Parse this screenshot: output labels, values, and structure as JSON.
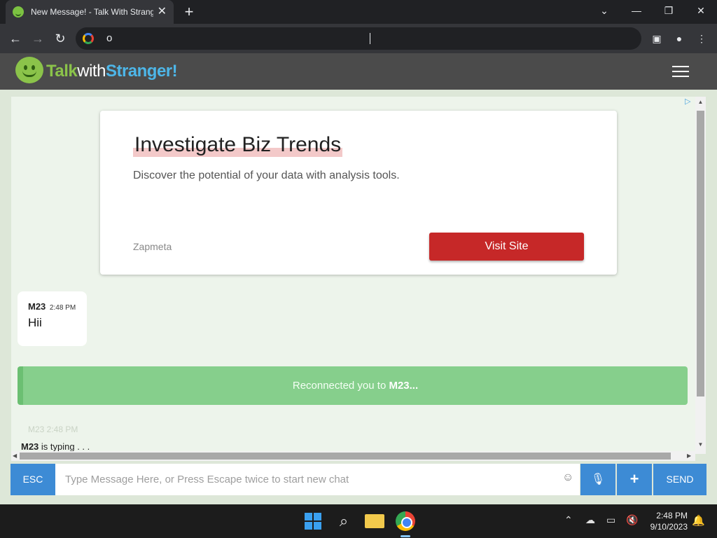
{
  "browser": {
    "tab_title": "New Message! - Talk With Strang",
    "tab_close": "✕",
    "new_tab": "+",
    "address_text": "o",
    "window_controls": {
      "menu": "⌄",
      "minimize": "—",
      "restore": "❐",
      "close": "✕"
    }
  },
  "site": {
    "logo_talk": "Talk",
    "logo_with": "with",
    "logo_stranger": "Stranger!"
  },
  "ad": {
    "marker": "▷",
    "headline": "Investigate Biz Trends",
    "description": "Discover the potential of your data with analysis tools.",
    "brand": "Zapmeta",
    "cta": "Visit Site"
  },
  "chat": {
    "messages": [
      {
        "sender": "M23",
        "time": "2:48 PM",
        "text": "Hii"
      }
    ],
    "reconnect_prefix": "Reconnected you to ",
    "reconnect_name": "M23...",
    "ghost_text": "M23 2:48 PM",
    "typing_name": "M23",
    "typing_suffix": " is typing . . ."
  },
  "composer": {
    "esc_label": "ESC",
    "placeholder": "Type Message Here, or Press Escape twice to start new chat",
    "emoji": "☺",
    "mic": "🎙",
    "plus": "+",
    "send_label": "SEND"
  },
  "taskbar": {
    "time": "2:48 PM",
    "date": "9/10/2023",
    "tray_chevron": "⌃",
    "bell": "🔔"
  },
  "colors": {
    "accent_blue": "#3d8bd5",
    "reconnect_green": "#86cf8c",
    "cta_red": "#c62828",
    "logo_green": "#8bc34a"
  }
}
